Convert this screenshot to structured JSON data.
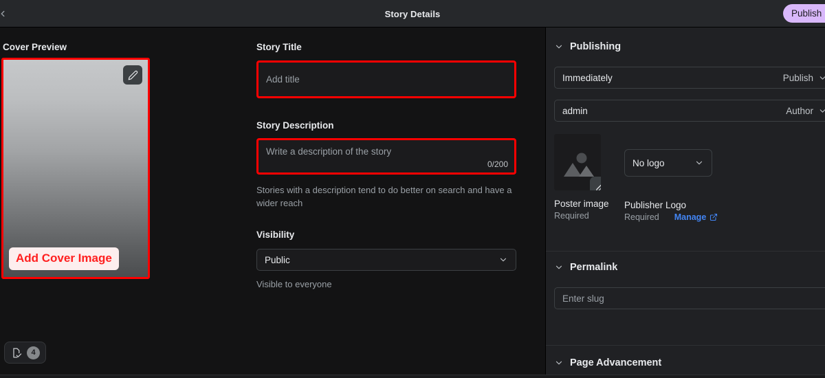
{
  "topbar": {
    "back_icon": "chevron-left-icon",
    "title": "Story Details",
    "publish_label": "Publish"
  },
  "cover": {
    "section_label": "Cover Preview",
    "edit_icon": "pencil-icon",
    "add_cover_label": "Add Cover Image"
  },
  "page_chip": {
    "doc_icon": "page-check-icon",
    "count": "4"
  },
  "story": {
    "title_label": "Story Title",
    "title_value": "",
    "title_placeholder": "Add title",
    "description_label": "Story Description",
    "description_value": "",
    "description_placeholder": "Write a description of the story",
    "description_counter": "0/200",
    "description_helper": "Stories with a description tend to do better on search and have a wider reach",
    "visibility_label": "Visibility",
    "visibility_value": "Public",
    "visibility_helper": "Visible to everyone",
    "visibility_chevron": "chevron-down-icon"
  },
  "panel": {
    "publishing": {
      "heading": "Publishing",
      "chevron": "chevron-down-icon",
      "schedule_value": "Immediately",
      "schedule_action": "Publish",
      "author_value": "admin",
      "author_action": "Author"
    },
    "poster": {
      "placeholder_icon": "image-placeholder-icon",
      "edit_icon": "pencil-icon",
      "caption": "Poster image",
      "status": "Required"
    },
    "publisher_logo": {
      "select_value": "No logo",
      "select_chevron": "chevron-down-icon",
      "caption": "Publisher Logo",
      "status": "Required",
      "manage_label": "Manage",
      "manage_icon": "external-link-icon"
    },
    "permalink": {
      "heading": "Permalink",
      "chevron": "chevron-down-icon",
      "slug_value": "",
      "slug_placeholder": "Enter slug"
    },
    "page_advancement": {
      "heading": "Page Advancement",
      "chevron": "chevron-down-icon"
    }
  },
  "colors": {
    "accent_publish": "#d9b8fb",
    "highlight_border": "#ff0000",
    "link": "#4285f4",
    "panel_bg": "#202124",
    "app_bg": "#131314"
  }
}
